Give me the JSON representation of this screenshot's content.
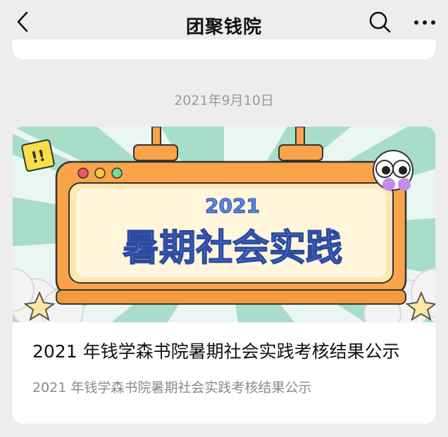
{
  "header": {
    "title": "团聚钱院",
    "icons": [
      "back-icon",
      "search-icon",
      "more-icon"
    ]
  },
  "message": {
    "date": "2021年9月10日",
    "card": {
      "banner_year": "2021",
      "banner_text": "暑期社会实践",
      "title": "2021 年钱学森书院暑期社会实践考核结果公示",
      "description": "2021 年钱学森书院暑期社会实践考核结果公示"
    }
  },
  "colors": {
    "background": "#ededed",
    "card": "#ffffff",
    "banner_frame": "#f9a34a",
    "banner_inner": "#fde7b4",
    "banner_text": "#5b84e8",
    "banner_rays": "#9fdcc5"
  }
}
